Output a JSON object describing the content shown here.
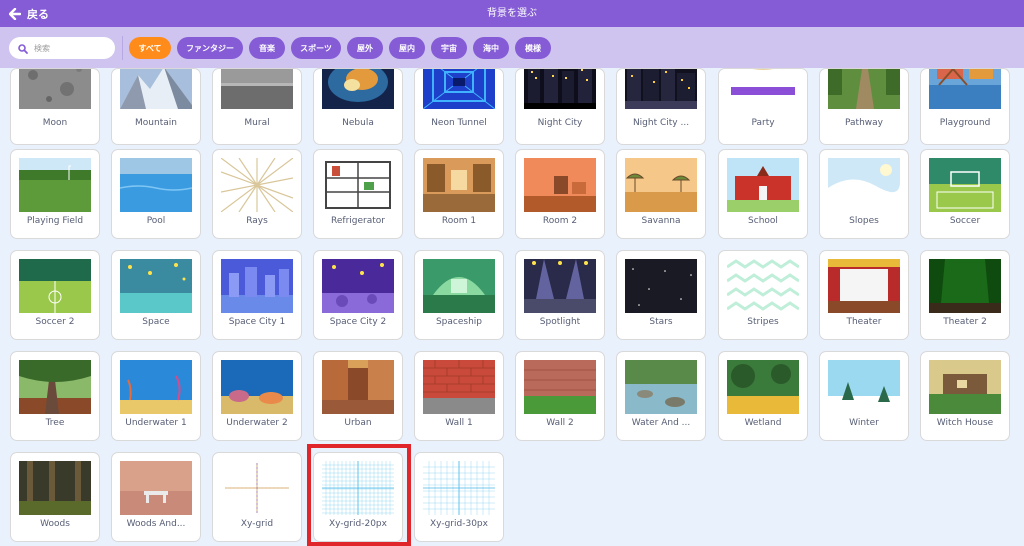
{
  "header": {
    "back_label": "戻る",
    "title": "背景を選ぶ",
    "color": "#855cd6"
  },
  "search": {
    "placeholder": "検索"
  },
  "tags": [
    {
      "label": "すべて",
      "active": true
    },
    {
      "label": "ファンタジー",
      "active": false
    },
    {
      "label": "音楽",
      "active": false
    },
    {
      "label": "スポーツ",
      "active": false
    },
    {
      "label": "屋外",
      "active": false
    },
    {
      "label": "屋内",
      "active": false
    },
    {
      "label": "宇宙",
      "active": false
    },
    {
      "label": "海中",
      "active": false
    },
    {
      "label": "模様",
      "active": false
    }
  ],
  "backdrops": [
    {
      "label": "Moon",
      "icon": "moon-thumbnail"
    },
    {
      "label": "Mountain",
      "icon": "mountain-thumbnail"
    },
    {
      "label": "Mural",
      "icon": "mural-thumbnail"
    },
    {
      "label": "Nebula",
      "icon": "nebula-thumbnail"
    },
    {
      "label": "Neon Tunnel",
      "icon": "neon-tunnel-thumbnail"
    },
    {
      "label": "Night City",
      "icon": "night-city-thumbnail"
    },
    {
      "label": "Night City ...",
      "icon": "night-city-2-thumbnail"
    },
    {
      "label": "Party",
      "icon": "party-thumbnail"
    },
    {
      "label": "Pathway",
      "icon": "pathway-thumbnail"
    },
    {
      "label": "Playground",
      "icon": "playground-thumbnail"
    },
    {
      "label": "Playing Field",
      "icon": "playing-field-thumbnail"
    },
    {
      "label": "Pool",
      "icon": "pool-thumbnail"
    },
    {
      "label": "Rays",
      "icon": "rays-thumbnail"
    },
    {
      "label": "Refrigerator",
      "icon": "refrigerator-thumbnail"
    },
    {
      "label": "Room 1",
      "icon": "room-1-thumbnail"
    },
    {
      "label": "Room 2",
      "icon": "room-2-thumbnail"
    },
    {
      "label": "Savanna",
      "icon": "savanna-thumbnail"
    },
    {
      "label": "School",
      "icon": "school-thumbnail"
    },
    {
      "label": "Slopes",
      "icon": "slopes-thumbnail"
    },
    {
      "label": "Soccer",
      "icon": "soccer-thumbnail"
    },
    {
      "label": "Soccer 2",
      "icon": "soccer-2-thumbnail"
    },
    {
      "label": "Space",
      "icon": "space-thumbnail"
    },
    {
      "label": "Space City 1",
      "icon": "space-city-1-thumbnail"
    },
    {
      "label": "Space City 2",
      "icon": "space-city-2-thumbnail"
    },
    {
      "label": "Spaceship",
      "icon": "spaceship-thumbnail"
    },
    {
      "label": "Spotlight",
      "icon": "spotlight-thumbnail"
    },
    {
      "label": "Stars",
      "icon": "stars-thumbnail"
    },
    {
      "label": "Stripes",
      "icon": "stripes-thumbnail"
    },
    {
      "label": "Theater",
      "icon": "theater-thumbnail"
    },
    {
      "label": "Theater 2",
      "icon": "theater-2-thumbnail"
    },
    {
      "label": "Tree",
      "icon": "tree-thumbnail"
    },
    {
      "label": "Underwater 1",
      "icon": "underwater-1-thumbnail"
    },
    {
      "label": "Underwater 2",
      "icon": "underwater-2-thumbnail"
    },
    {
      "label": "Urban",
      "icon": "urban-thumbnail"
    },
    {
      "label": "Wall 1",
      "icon": "wall-1-thumbnail"
    },
    {
      "label": "Wall 2",
      "icon": "wall-2-thumbnail"
    },
    {
      "label": "Water And ...",
      "icon": "water-and-rocks-thumbnail"
    },
    {
      "label": "Wetland",
      "icon": "wetland-thumbnail"
    },
    {
      "label": "Winter",
      "icon": "winter-thumbnail"
    },
    {
      "label": "Witch House",
      "icon": "witch-house-thumbnail"
    },
    {
      "label": "Woods",
      "icon": "woods-thumbnail"
    },
    {
      "label": "Woods And...",
      "icon": "woods-and-bench-thumbnail"
    },
    {
      "label": "Xy-grid",
      "icon": "xy-grid-thumbnail"
    },
    {
      "label": "Xy-grid-20px",
      "icon": "xy-grid-20px-thumbnail"
    },
    {
      "label": "Xy-grid-30px",
      "icon": "xy-grid-30px-thumbnail"
    }
  ],
  "colors": {
    "accent": "#855cd6",
    "active_tag": "#ff8c1a",
    "highlight": "#e0262b"
  }
}
